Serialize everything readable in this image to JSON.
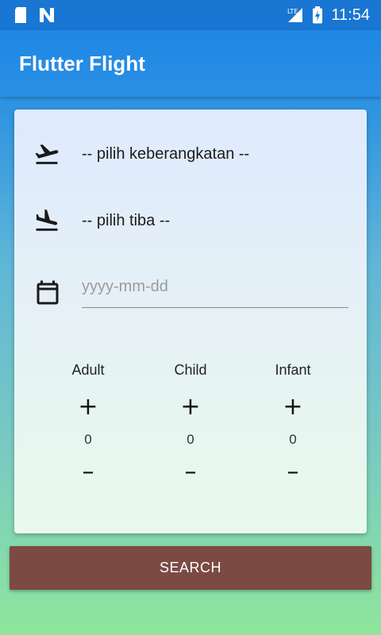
{
  "status_bar": {
    "time": "11:54",
    "network": "LTE"
  },
  "app_bar": {
    "title": "Flutter Flight"
  },
  "form": {
    "departure_placeholder": "-- pilih keberangkatan --",
    "arrival_placeholder": "-- pilih tiba --",
    "date_placeholder": "yyyy-mm-dd",
    "departure_icon": "flight-takeoff-icon",
    "arrival_icon": "flight-land-icon",
    "date_icon": "calendar-icon"
  },
  "passengers": [
    {
      "label": "Adult",
      "count": "0",
      "plus": "+",
      "minus": "–"
    },
    {
      "label": "Child",
      "count": "0",
      "plus": "+",
      "minus": "–"
    },
    {
      "label": "Infant",
      "count": "0",
      "plus": "+",
      "minus": "–"
    }
  ],
  "search_button": {
    "label": "SEARCH",
    "color": "#7b4a42"
  },
  "colors": {
    "primary": "#1e88e5",
    "status_bar": "#1976d2"
  }
}
